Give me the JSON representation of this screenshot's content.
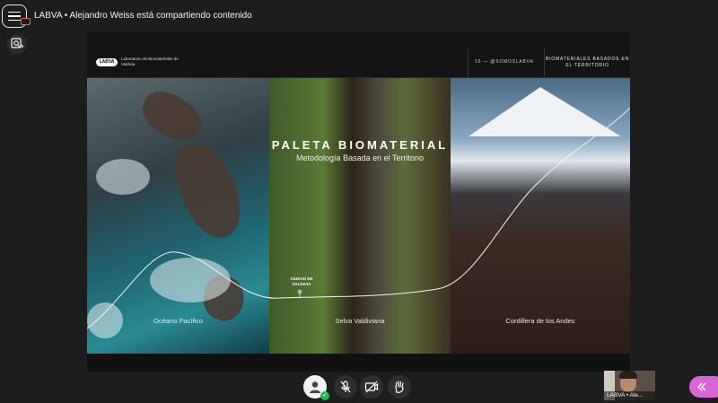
{
  "header": {
    "title": "LABVA • Alejandro Weiss está compartiendo contenido",
    "menu_icon": "hamburger-menu-icon",
    "share_icon": "screen-share-icon"
  },
  "slide": {
    "logo": "LABVA",
    "lab_name": "Laboratorio de Biomateriales de Valdivia",
    "handle": "16 — @SOMOSLABVA",
    "section_tag": "BIOMATERIALES BASADOS EN EL TERRITORIO",
    "title": "PALETA BIOMATERIAL",
    "subtitle": "Metodología Basada en el Territorio",
    "city_label": "CIUDAD DE VALDIVIA",
    "panels": [
      {
        "label": "Océano Pacífico"
      },
      {
        "label": "Selva Valdiviana"
      },
      {
        "label": "Cordillera de los Andes"
      }
    ]
  },
  "toolbar": {
    "user_icon": "user-avatar-icon",
    "mic_icon": "microphone-muted-icon",
    "camera_icon": "camera-off-icon",
    "hand_icon": "raise-hand-icon"
  },
  "participant": {
    "label": "LABVA • Ale..."
  },
  "colors": {
    "background": "#1d1d1d",
    "accent": "#d966d6",
    "status_ok": "#1db954"
  }
}
